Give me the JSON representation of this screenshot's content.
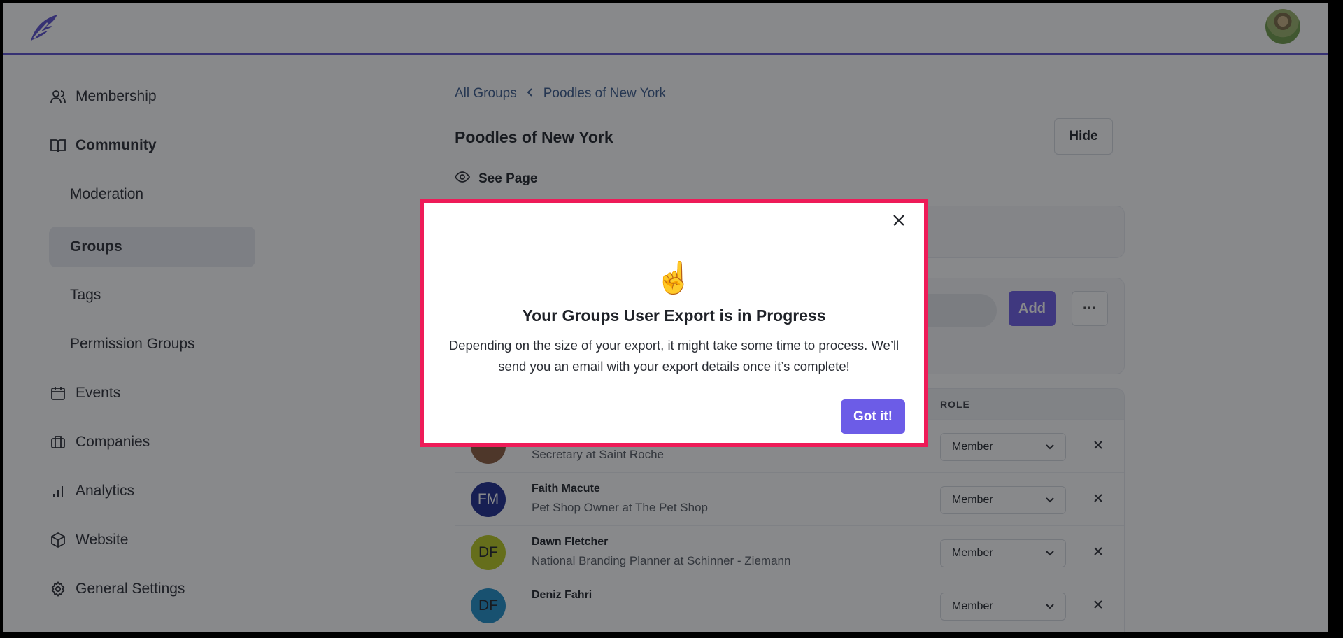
{
  "header": {
    "logo_icon": "feather-logo-icon",
    "avatar_icon": "user-avatar"
  },
  "sidebar": {
    "items": [
      {
        "label": "Membership",
        "icon": "users-icon"
      },
      {
        "label": "Community",
        "icon": "book-open-icon"
      },
      {
        "label": "Moderation"
      },
      {
        "label": "Groups"
      },
      {
        "label": "Tags"
      },
      {
        "label": "Permission Groups"
      },
      {
        "label": "Events",
        "icon": "calendar-icon"
      },
      {
        "label": "Companies",
        "icon": "briefcase-icon"
      },
      {
        "label": "Analytics",
        "icon": "bar-chart-icon"
      },
      {
        "label": "Website",
        "icon": "cube-icon"
      },
      {
        "label": "General Settings",
        "icon": "gear-icon"
      }
    ]
  },
  "main": {
    "breadcrumb": {
      "root": "All Groups",
      "current": "Poodles of New York"
    },
    "title": "Poodles of New York",
    "hide_label": "Hide",
    "see_page_label": "See Page",
    "add_label": "Add",
    "more_label": "···",
    "table": {
      "role_header": "ROLE",
      "rows": [
        {
          "initials": "",
          "name": "",
          "title": "Secretary at Saint Roche",
          "role": "Member",
          "avatar_color": "#8a5a3c"
        },
        {
          "initials": "FM",
          "name": "Faith Macute",
          "title": "Pet Shop Owner at The Pet Shop",
          "role": "Member",
          "avatar_color": "#1c2a8f"
        },
        {
          "initials": "DF",
          "name": "Dawn Fletcher",
          "title": "National Branding Planner at Schinner - Ziemann",
          "role": "Member",
          "avatar_color": "#b8c81e"
        },
        {
          "initials": "DF",
          "name": "Deniz Fahri",
          "title": "",
          "role": "Member",
          "avatar_color": "#1f8fc9"
        }
      ]
    }
  },
  "modal": {
    "emoji": "☝️",
    "title": "Your Groups User Export is in Progress",
    "body": "Depending on the size of your export, it might take some time to process. We’ll send you an email with your export details once it’s complete!",
    "button_label": "Got it!",
    "highlight_color": "#ee1b58",
    "accent_color": "#6c5ce7"
  }
}
